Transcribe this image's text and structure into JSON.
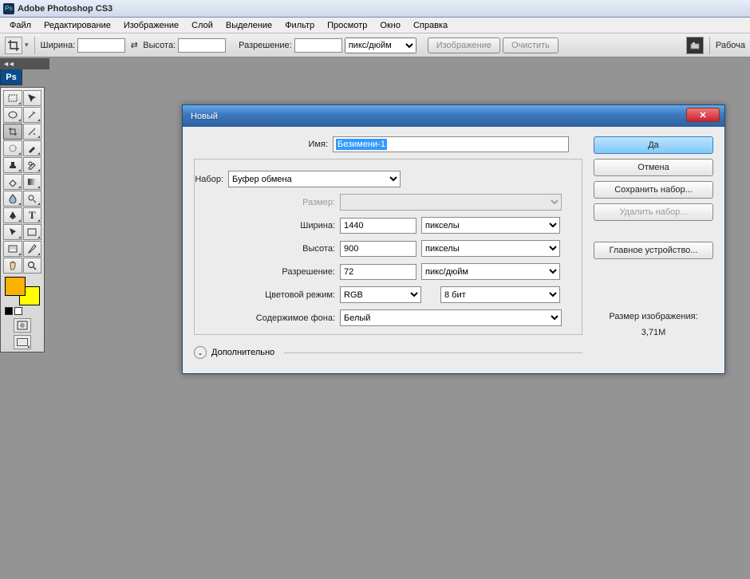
{
  "app": {
    "title": "Adobe Photoshop CS3",
    "ps_abbrev": "Ps"
  },
  "menu": [
    "Файл",
    "Редактирование",
    "Изображение",
    "Слой",
    "Выделение",
    "Фильтр",
    "Просмотр",
    "Окно",
    "Справка"
  ],
  "optbar": {
    "width_label": "Ширина:",
    "height_label": "Высота:",
    "res_label": "Разрешение:",
    "units": "пикс/дюйм",
    "btn_image": "Изображение",
    "btn_clear": "Очистить",
    "right_label": "Рабоча"
  },
  "dialog": {
    "title": "Новый",
    "name_label": "Имя:",
    "name_value": "Безимени-1",
    "preset_label": "Набор:",
    "preset_value": "Буфер обмена",
    "size_label": "Размер:",
    "width_label": "Ширина:",
    "width_value": "1440",
    "width_units": "пикселы",
    "height_label": "Высота:",
    "height_value": "900",
    "height_units": "пикселы",
    "res_label": "Разрешение:",
    "res_value": "72",
    "res_units": "пикс/дюйм",
    "mode_label": "Цветовой режим:",
    "mode_value": "RGB",
    "depth_value": "8 бит",
    "bg_label": "Содержимое фона:",
    "bg_value": "Белый",
    "advanced": "Дополнительно",
    "btn_ok": "Да",
    "btn_cancel": "Отмена",
    "btn_save_preset": "Сохранить набор...",
    "btn_delete_preset": "Удалить набор...",
    "btn_device": "Главное устройство...",
    "imgsize_label": "Размер изображения:",
    "imgsize_value": "3,71M"
  }
}
